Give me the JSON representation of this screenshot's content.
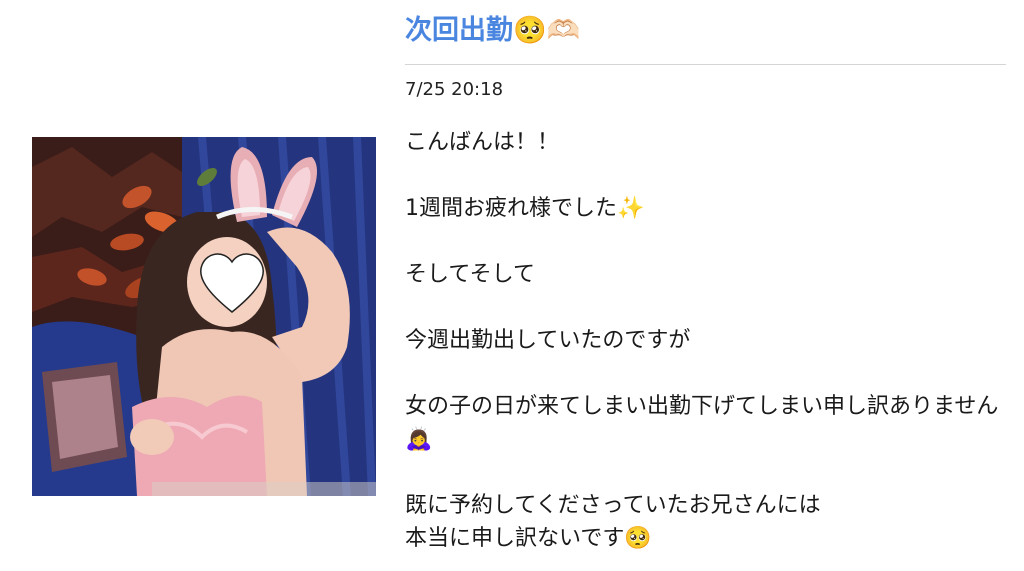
{
  "post": {
    "title": "次回出勤🥺🫶🏻",
    "date": "7/25 20:18",
    "paragraphs": [
      "こんばんは！！",
      "1週間お疲れ様でした✨",
      "そしてそして",
      "今週出勤出していたのですが",
      "女の子の日が来てしまい出勤下げてしまい申し訳ありません🙇‍♀️",
      "既に予約してくださっていたお兄さんには",
      "本当に申し訳ないです🥺"
    ]
  },
  "colors": {
    "title": "#4a86e0",
    "divider": "#d5d5d5",
    "text": "#1a1a1a"
  },
  "image": {
    "icon": "photo",
    "heart_sticker": "heart-sticker-icon"
  }
}
